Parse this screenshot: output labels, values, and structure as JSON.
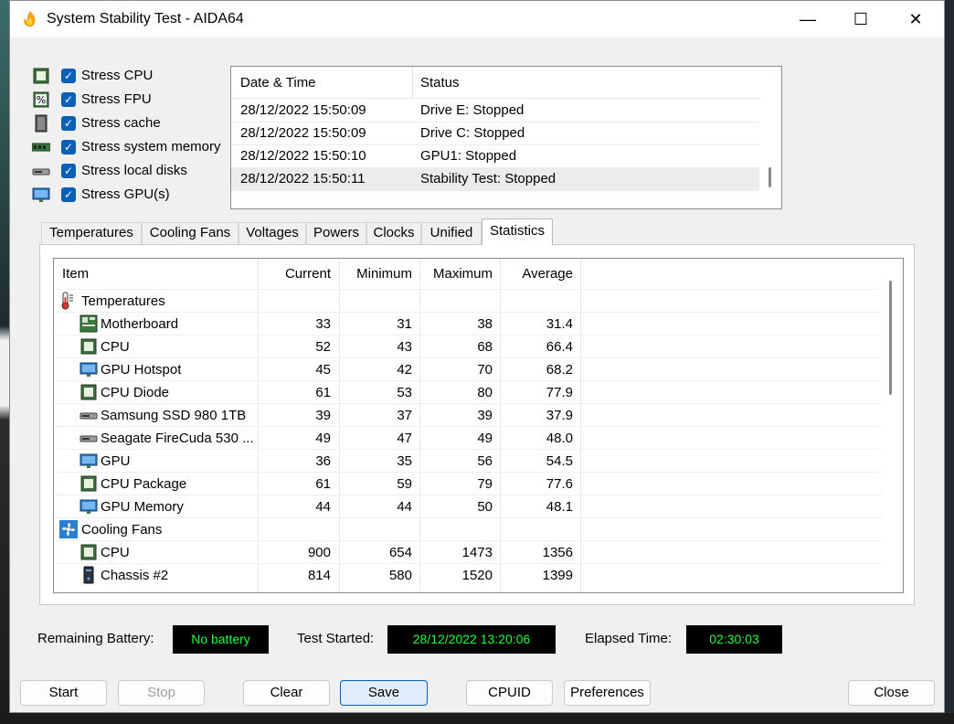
{
  "window": {
    "title": "System Stability Test - AIDA64",
    "minimize_glyph": "—",
    "maximize_glyph": "☐",
    "close_glyph": "✕"
  },
  "stress_options": [
    {
      "label": "Stress CPU",
      "checked": true,
      "icon": "cpu-chip-icon"
    },
    {
      "label": "Stress FPU",
      "checked": true,
      "icon": "fpu-percent-icon"
    },
    {
      "label": "Stress cache",
      "checked": true,
      "icon": "cache-icon"
    },
    {
      "label": "Stress system memory",
      "checked": true,
      "icon": "memory-module-icon"
    },
    {
      "label": "Stress local disks",
      "checked": true,
      "icon": "disk-drive-icon"
    },
    {
      "label": "Stress GPU(s)",
      "checked": true,
      "icon": "gpu-monitor-icon"
    }
  ],
  "log": {
    "headers": {
      "datetime": "Date & Time",
      "status": "Status"
    },
    "rows": [
      {
        "datetime": "28/12/2022 15:50:09",
        "status": "Drive E: Stopped"
      },
      {
        "datetime": "28/12/2022 15:50:09",
        "status": "Drive C: Stopped"
      },
      {
        "datetime": "28/12/2022 15:50:10",
        "status": "GPU1: Stopped"
      },
      {
        "datetime": "28/12/2022 15:50:11",
        "status": "Stability Test: Stopped",
        "selected": true
      }
    ]
  },
  "tabs": [
    {
      "label": "Temperatures"
    },
    {
      "label": "Cooling Fans"
    },
    {
      "label": "Voltages"
    },
    {
      "label": "Powers"
    },
    {
      "label": "Clocks"
    },
    {
      "label": "Unified"
    },
    {
      "label": "Statistics",
      "active": true
    }
  ],
  "stats": {
    "headers": {
      "item": "Item",
      "current": "Current",
      "minimum": "Minimum",
      "maximum": "Maximum",
      "average": "Average"
    },
    "rows": [
      {
        "type": "group",
        "item": "Temperatures",
        "icon": "thermometer-icon"
      },
      {
        "item": "Motherboard",
        "icon": "motherboard-icon",
        "current": "33",
        "minimum": "31",
        "maximum": "38",
        "average": "31.4"
      },
      {
        "item": "CPU",
        "icon": "cpu-chip-icon",
        "current": "52",
        "minimum": "43",
        "maximum": "68",
        "average": "66.4"
      },
      {
        "item": "GPU Hotspot",
        "icon": "gpu-monitor-icon",
        "current": "45",
        "minimum": "42",
        "maximum": "70",
        "average": "68.2"
      },
      {
        "item": "CPU Diode",
        "icon": "cpu-chip-icon",
        "current": "61",
        "minimum": "53",
        "maximum": "80",
        "average": "77.9"
      },
      {
        "item": "Samsung SSD 980 1TB",
        "icon": "disk-drive-icon",
        "current": "39",
        "minimum": "37",
        "maximum": "39",
        "average": "37.9"
      },
      {
        "item": "Seagate FireCuda 530 ...",
        "icon": "disk-drive-icon",
        "current": "49",
        "minimum": "47",
        "maximum": "49",
        "average": "48.0"
      },
      {
        "item": "GPU",
        "icon": "gpu-monitor-icon",
        "current": "36",
        "minimum": "35",
        "maximum": "56",
        "average": "54.5"
      },
      {
        "item": "CPU Package",
        "icon": "cpu-chip-icon",
        "current": "61",
        "minimum": "59",
        "maximum": "79",
        "average": "77.6"
      },
      {
        "item": "GPU Memory",
        "icon": "gpu-monitor-icon",
        "current": "44",
        "minimum": "44",
        "maximum": "50",
        "average": "48.1"
      },
      {
        "type": "group",
        "item": "Cooling Fans",
        "icon": "fan-icon"
      },
      {
        "item": "CPU",
        "icon": "cpu-chip-icon",
        "current": "900",
        "minimum": "654",
        "maximum": "1473",
        "average": "1356"
      },
      {
        "item": "Chassis #2",
        "icon": "chassis-icon",
        "current": "814",
        "minimum": "580",
        "maximum": "1520",
        "average": "1399"
      }
    ]
  },
  "info": {
    "battery_label": "Remaining Battery:",
    "battery_value": "No battery",
    "started_label": "Test Started:",
    "started_value": "28/12/2022 13:20:06",
    "elapsed_label": "Elapsed Time:",
    "elapsed_value": "02:30:03"
  },
  "buttons": {
    "start": "Start",
    "stop": "Stop",
    "clear": "Clear",
    "save": "Save",
    "cpuid": "CPUID",
    "preferences": "Preferences",
    "close": "Close"
  },
  "colors": {
    "lcd_text": "#1fff3a",
    "checkbox": "#0a5fb6",
    "accent_default_button": "#0a5fb6"
  }
}
